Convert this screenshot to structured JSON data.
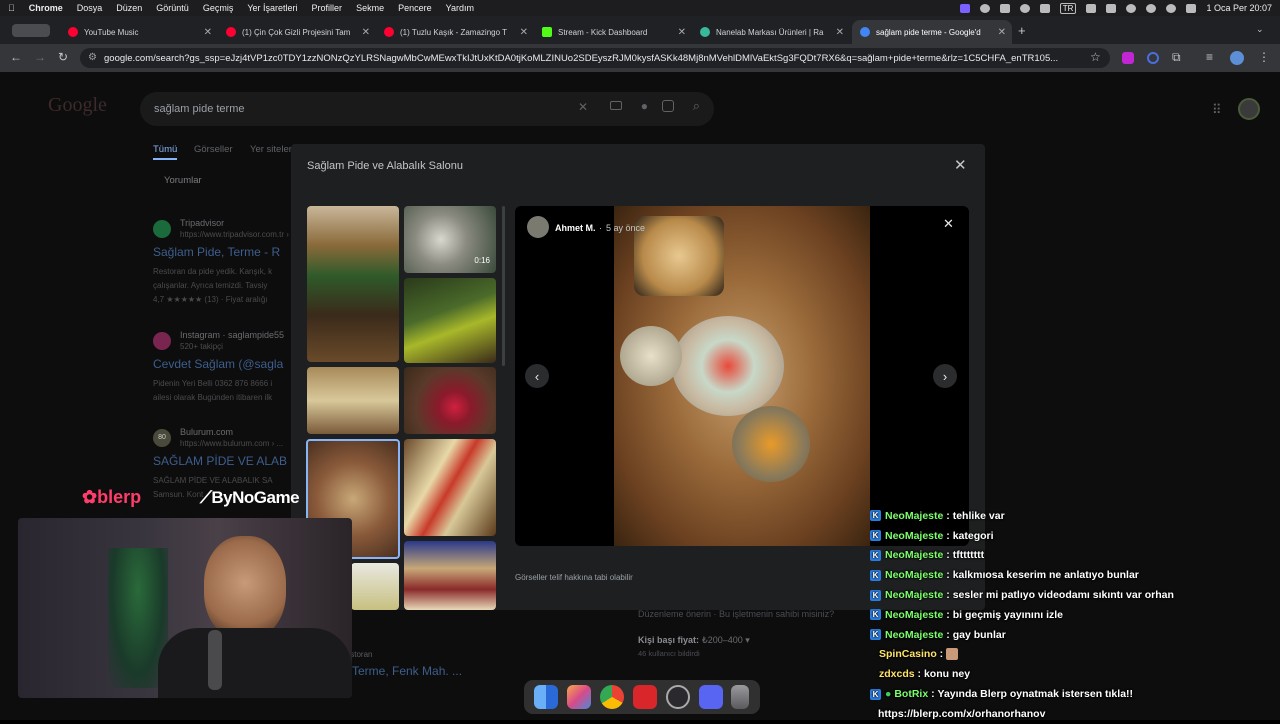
{
  "menubar": {
    "app": "Chrome",
    "items": [
      "Dosya",
      "Düzen",
      "Görüntü",
      "Geçmiş",
      "Yer İşaretleri",
      "Profiller",
      "Sekme",
      "Pencere",
      "Yardım"
    ],
    "datetime": "1 Oca Per  20:07",
    "input_lang": "TR"
  },
  "tabs": [
    {
      "label": "YouTube Music",
      "color": "#ff0033"
    },
    {
      "label": "(1) Çin Çok Gizli Projesini Tam",
      "color": "#ff0033"
    },
    {
      "label": "(1) Tuzlu Kaşık - Zamazingo T",
      "color": "#ff0033"
    },
    {
      "label": "Stream - Kick Dashboard",
      "color": "#53fc18"
    },
    {
      "label": "Nanelab Markası Ürünleri | Ra",
      "color": "#3ab89a"
    },
    {
      "label": "sağlam pide terme - Google'd",
      "color": "#4285f4"
    }
  ],
  "address_bar": {
    "url": "google.com/search?gs_ssp=eJzj4tVP1zc0TDY1zzNONzQzYLRSNagwMbCwMEwxTkIJtUxKtDA0tjKoMLZINUo2SDEyszRJM0kysfASKk48Mj8nMVehlDMlVaEktSg3FQDt7RX6&q=sağlam+pide+terme&rlz=1C5CHFA_enTR105..."
  },
  "google": {
    "logo": "Google",
    "query": "sağlam pide terme",
    "tabs": [
      "Tümü",
      "Görseller",
      "Yer siteleri"
    ],
    "reviews_tab": "Yorumlar",
    "results": [
      {
        "site": "Tripadvisor",
        "url": "https://www.tripadvisor.com.tr › ...",
        "title": "Sağlam Pide, Terme - R",
        "desc1": "Restoran da pide yedik. Kanşık, k",
        "desc2": "çalışanlar. Ayrıca temizdi. Tavsiy",
        "rating": "4,7 ★★★★★ (13) · Fiyat aralığı"
      },
      {
        "site": "Instagram · saglampide55",
        "url": "520+ takipçi",
        "title": "Cevdet Sağlam (@sagla",
        "desc1": "Pidenin Yeri Belli 0362 876 8666 i",
        "desc2": "ailesi olarak Bugünden itibaren ilk"
      },
      {
        "site": "Bulurum.com",
        "url": "https://www.bulurum.com › ...",
        "title": "SAĞLAM PİDE VE ALAB",
        "desc1": "SAĞLAM PİDE VE ALABALIK SA",
        "desc2": "Samsun. Kont"
      }
    ],
    "below_modal": {
      "suggest": "Düzenleme önerin · Bu işletmenin sahibi misiniz?",
      "price_label": "Kişi başı fiyat:",
      "price_value": " ₺200–400 ▾",
      "reporters": "46 kullanıcı bildirdi",
      "category": "Restoran",
      "address": "Terme, Fenk Mah. ..."
    }
  },
  "modal": {
    "title": "Sağlam Pide ve Alabalık Salonu",
    "thumb_badge": "0:16",
    "viewer": {
      "author": "Ahmet M.",
      "time": "5 ay önce"
    },
    "copyright": "Görseller telif hakkına tabi olabilir"
  },
  "stream": {
    "blerp": "blerp",
    "channel": "ByNoGame",
    "chat": [
      {
        "user": "NeoMajeste",
        "msg": "tehlike var",
        "color": "#7cff6b",
        "kind": "kick"
      },
      {
        "user": "NeoMajeste",
        "msg": "kategori",
        "color": "#7cff6b",
        "kind": "kick"
      },
      {
        "user": "NeoMajeste",
        "msg": "tfttttttt",
        "color": "#7cff6b",
        "kind": "kick"
      },
      {
        "user": "NeoMajeste",
        "msg": "kalkmıosa keserim ne anlatıyo bunlar",
        "color": "#7cff6b",
        "kind": "kick"
      },
      {
        "user": "NeoMajeste",
        "msg": "sesler mi patlıyo videodamı sıkıntı var orhan",
        "color": "#7cff6b",
        "kind": "kick"
      },
      {
        "user": "NeoMajeste",
        "msg": "bi geçmiş yayınını izle",
        "color": "#7cff6b",
        "kind": "kick"
      },
      {
        "user": "NeoMajeste",
        "msg": "gay bunlar",
        "color": "#7cff6b",
        "kind": "kick"
      },
      {
        "user": "SpinCasino",
        "msg": "",
        "color": "#ffe36b",
        "kind": "plain"
      },
      {
        "user": "zdxcds",
        "msg": "konu ney",
        "color": "#ffe36b",
        "kind": "plain"
      },
      {
        "user": "BotRix",
        "msg": "Yayında Blerp oynatmak istersen tıkla!!",
        "color": "#7cff6b",
        "kind": "bot"
      }
    ],
    "bot_link": "https://blerp.com/x/orhanorhanov"
  },
  "dock": [
    "finder-icon",
    "launchpad-icon",
    "chrome-icon",
    "app-icon",
    "obs-icon",
    "discord-icon",
    "trash-icon"
  ]
}
